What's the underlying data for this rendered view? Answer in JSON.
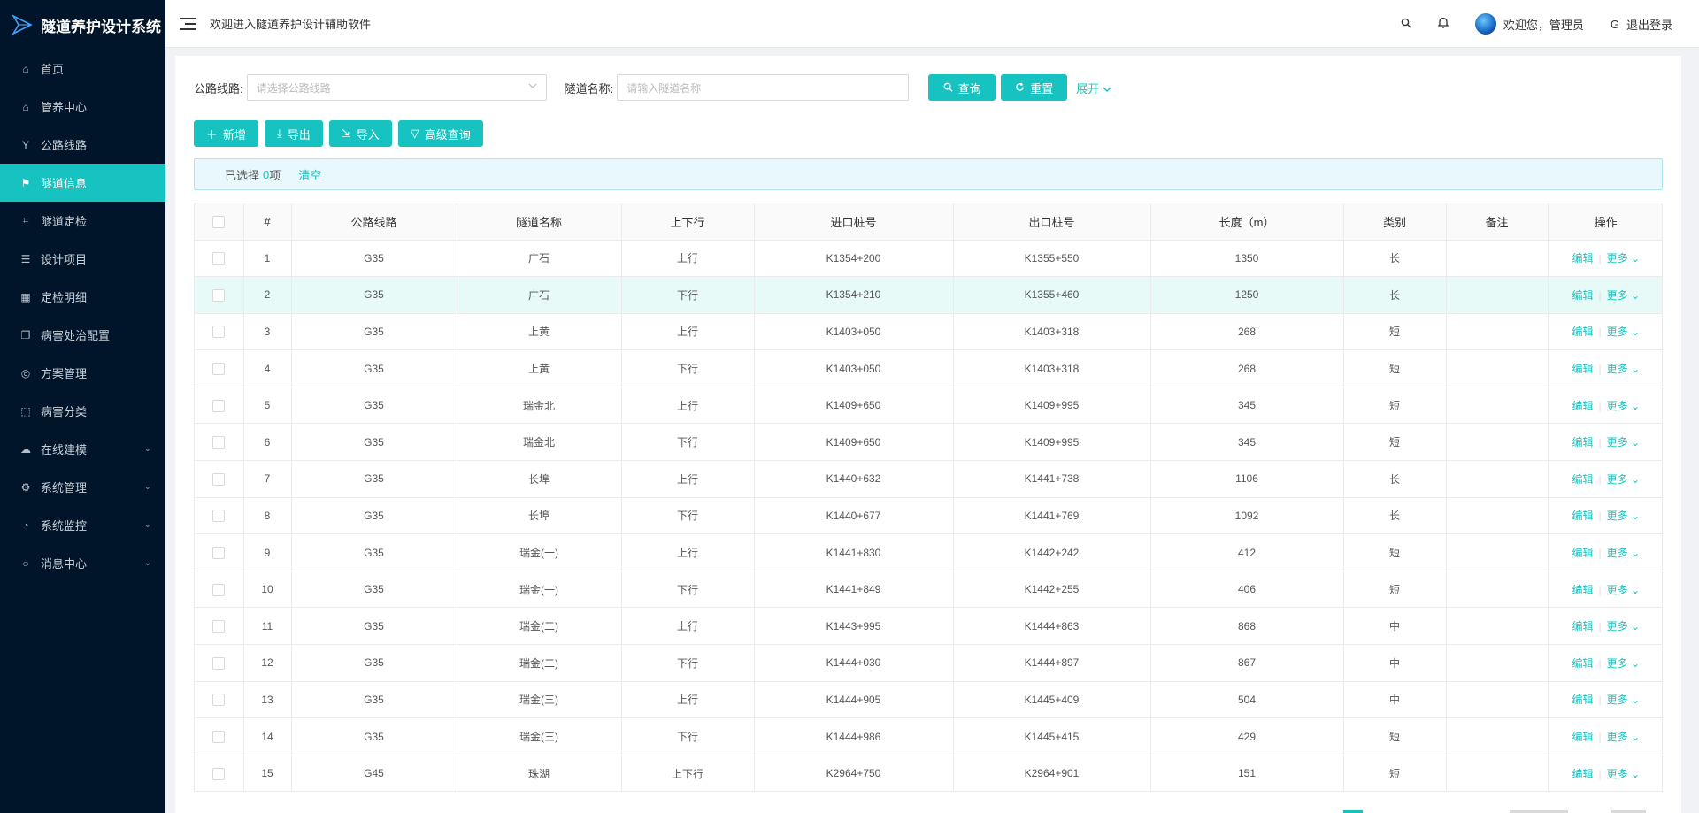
{
  "app": {
    "logo_text": "隧道养护设计系统",
    "welcome": "欢迎进入隧道养护设计辅助软件"
  },
  "header": {
    "user_greeting": "欢迎您，管理员",
    "logout": "退出登录"
  },
  "sidebar": {
    "items": [
      {
        "label": "首页",
        "icon": "home-icon",
        "glyph": "⌂"
      },
      {
        "label": "管养中心",
        "icon": "bank-icon",
        "glyph": "⌂"
      },
      {
        "label": "公路线路",
        "icon": "branch-icon",
        "glyph": "Y"
      },
      {
        "label": "隧道信息",
        "icon": "flag-icon",
        "glyph": "⚑",
        "active": true
      },
      {
        "label": "隧道定检",
        "icon": "scan-icon",
        "glyph": "⌗"
      },
      {
        "label": "设计项目",
        "icon": "list-icon",
        "glyph": "☰"
      },
      {
        "label": "定检明细",
        "icon": "table-icon",
        "glyph": "▦"
      },
      {
        "label": "病害处治配置",
        "icon": "copy-icon",
        "glyph": "❐"
      },
      {
        "label": "方案管理",
        "icon": "compass-icon",
        "glyph": "◎"
      },
      {
        "label": "病害分类",
        "icon": "select-icon",
        "glyph": "⬚"
      },
      {
        "label": "在线建模",
        "icon": "cloud-icon",
        "glyph": "☁",
        "submenu": true
      },
      {
        "label": "系统管理",
        "icon": "gear-icon",
        "glyph": "⚙",
        "submenu": true
      },
      {
        "label": "系统监控",
        "icon": "dashboard-icon",
        "glyph": "◔",
        "submenu": true
      },
      {
        "label": "消息中心",
        "icon": "message-icon",
        "glyph": "○",
        "submenu": true
      }
    ]
  },
  "search": {
    "route_label": "公路线路:",
    "route_placeholder": "请选择公路线路",
    "tunnel_label": "隧道名称:",
    "tunnel_placeholder": "请输入隧道名称",
    "query": "查询",
    "reset": "重置",
    "expand": "展开"
  },
  "actions": {
    "add": "新增",
    "export": "导出",
    "import": "导入",
    "advanced": "高级查询"
  },
  "selection": {
    "prefix": "已选择",
    "count": "0",
    "suffix": "项",
    "clear": "清空"
  },
  "table": {
    "columns": [
      "#",
      "公路线路",
      "隧道名称",
      "上下行",
      "进口桩号",
      "出口桩号",
      "长度（m）",
      "类别",
      "备注",
      "操作"
    ],
    "edit": "编辑",
    "more": "更多",
    "rows": [
      {
        "no": "1",
        "route": "G35",
        "name": "广石",
        "dir": "上行",
        "entry": "K1354+200",
        "exit": "K1355+550",
        "length": "1350",
        "type": "长",
        "note": ""
      },
      {
        "no": "2",
        "route": "G35",
        "name": "广石",
        "dir": "下行",
        "entry": "K1354+210",
        "exit": "K1355+460",
        "length": "1250",
        "type": "长",
        "note": ""
      },
      {
        "no": "3",
        "route": "G35",
        "name": "上黄",
        "dir": "上行",
        "entry": "K1403+050",
        "exit": "K1403+318",
        "length": "268",
        "type": "短",
        "note": ""
      },
      {
        "no": "4",
        "route": "G35",
        "name": "上黄",
        "dir": "下行",
        "entry": "K1403+050",
        "exit": "K1403+318",
        "length": "268",
        "type": "短",
        "note": ""
      },
      {
        "no": "5",
        "route": "G35",
        "name": "瑞金北",
        "dir": "上行",
        "entry": "K1409+650",
        "exit": "K1409+995",
        "length": "345",
        "type": "短",
        "note": ""
      },
      {
        "no": "6",
        "route": "G35",
        "name": "瑞金北",
        "dir": "下行",
        "entry": "K1409+650",
        "exit": "K1409+995",
        "length": "345",
        "type": "短",
        "note": ""
      },
      {
        "no": "7",
        "route": "G35",
        "name": "长埠",
        "dir": "上行",
        "entry": "K1440+632",
        "exit": "K1441+738",
        "length": "1106",
        "type": "长",
        "note": ""
      },
      {
        "no": "8",
        "route": "G35",
        "name": "长埠",
        "dir": "下行",
        "entry": "K1440+677",
        "exit": "K1441+769",
        "length": "1092",
        "type": "长",
        "note": ""
      },
      {
        "no": "9",
        "route": "G35",
        "name": "瑞金(一)",
        "dir": "上行",
        "entry": "K1441+830",
        "exit": "K1442+242",
        "length": "412",
        "type": "短",
        "note": ""
      },
      {
        "no": "10",
        "route": "G35",
        "name": "瑞金(一)",
        "dir": "下行",
        "entry": "K1441+849",
        "exit": "K1442+255",
        "length": "406",
        "type": "短",
        "note": ""
      },
      {
        "no": "11",
        "route": "G35",
        "name": "瑞金(二)",
        "dir": "上行",
        "entry": "K1443+995",
        "exit": "K1444+863",
        "length": "868",
        "type": "中",
        "note": ""
      },
      {
        "no": "12",
        "route": "G35",
        "name": "瑞金(二)",
        "dir": "下行",
        "entry": "K1444+030",
        "exit": "K1444+897",
        "length": "867",
        "type": "中",
        "note": ""
      },
      {
        "no": "13",
        "route": "G35",
        "name": "瑞金(三)",
        "dir": "上行",
        "entry": "K1444+905",
        "exit": "K1445+409",
        "length": "504",
        "type": "中",
        "note": ""
      },
      {
        "no": "14",
        "route": "G35",
        "name": "瑞金(三)",
        "dir": "下行",
        "entry": "K1444+986",
        "exit": "K1445+415",
        "length": "429",
        "type": "短",
        "note": ""
      },
      {
        "no": "15",
        "route": "G45",
        "name": "珠湖",
        "dir": "上下行",
        "entry": "K2964+750",
        "exit": "K2964+901",
        "length": "151",
        "type": "短",
        "note": ""
      }
    ]
  },
  "colors": {
    "accent": "#17c3c0",
    "sidebar_bg": "#001529",
    "row_highlight": "#e8faf8"
  }
}
